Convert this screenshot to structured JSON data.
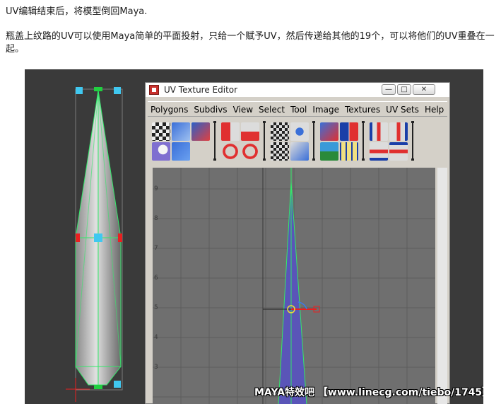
{
  "text": {
    "line1": "UV编辑结束后，将模型倒回Maya.",
    "line2": "瓶盖上纹路的UV可以使用Maya简单的平面投射，只给一个赋予UV，然后传递给其他的19个，可以将他们的UV重叠在一起。"
  },
  "window": {
    "title": "UV Texture Editor",
    "min_glyph": "—",
    "max_glyph": "□",
    "close_glyph": "✕"
  },
  "menu": [
    "Polygons",
    "Subdivs",
    "View",
    "Select",
    "Tool",
    "Image",
    "Textures",
    "UV Sets",
    "Help"
  ],
  "uv_ticks": [
    "9",
    "8",
    "7",
    "6",
    "5",
    "4",
    "3"
  ],
  "watermark": "MAYA特效吧 【www.linecg.com/tiebo/1745】",
  "colors": {
    "uv_shell": "#5a55b8",
    "grid_bg": "#6f6f6f",
    "wire": "#33e86a",
    "manip_red": "#e82020",
    "manip_yellow": "#f0e030",
    "handle_blue": "#40c8f0"
  },
  "icons": {
    "toolbar_row1": [
      "checker-icon",
      "move-uv-icon",
      "rotate-uv-icon",
      "flip-u-icon",
      "flip-v-icon",
      "unfold-icon",
      "layout-icon",
      "cut-icon",
      "sew-icon",
      "align-left-icon",
      "align-right-icon"
    ],
    "toolbar_row2": [
      "grab-icon",
      "snapshot-icon",
      "rotate-ccw-icon",
      "rotate-cw-icon",
      "map-icon",
      "relax-icon",
      "group-icon",
      "grid-snap-icon",
      "align-bottom-icon",
      "align-top-icon"
    ]
  }
}
